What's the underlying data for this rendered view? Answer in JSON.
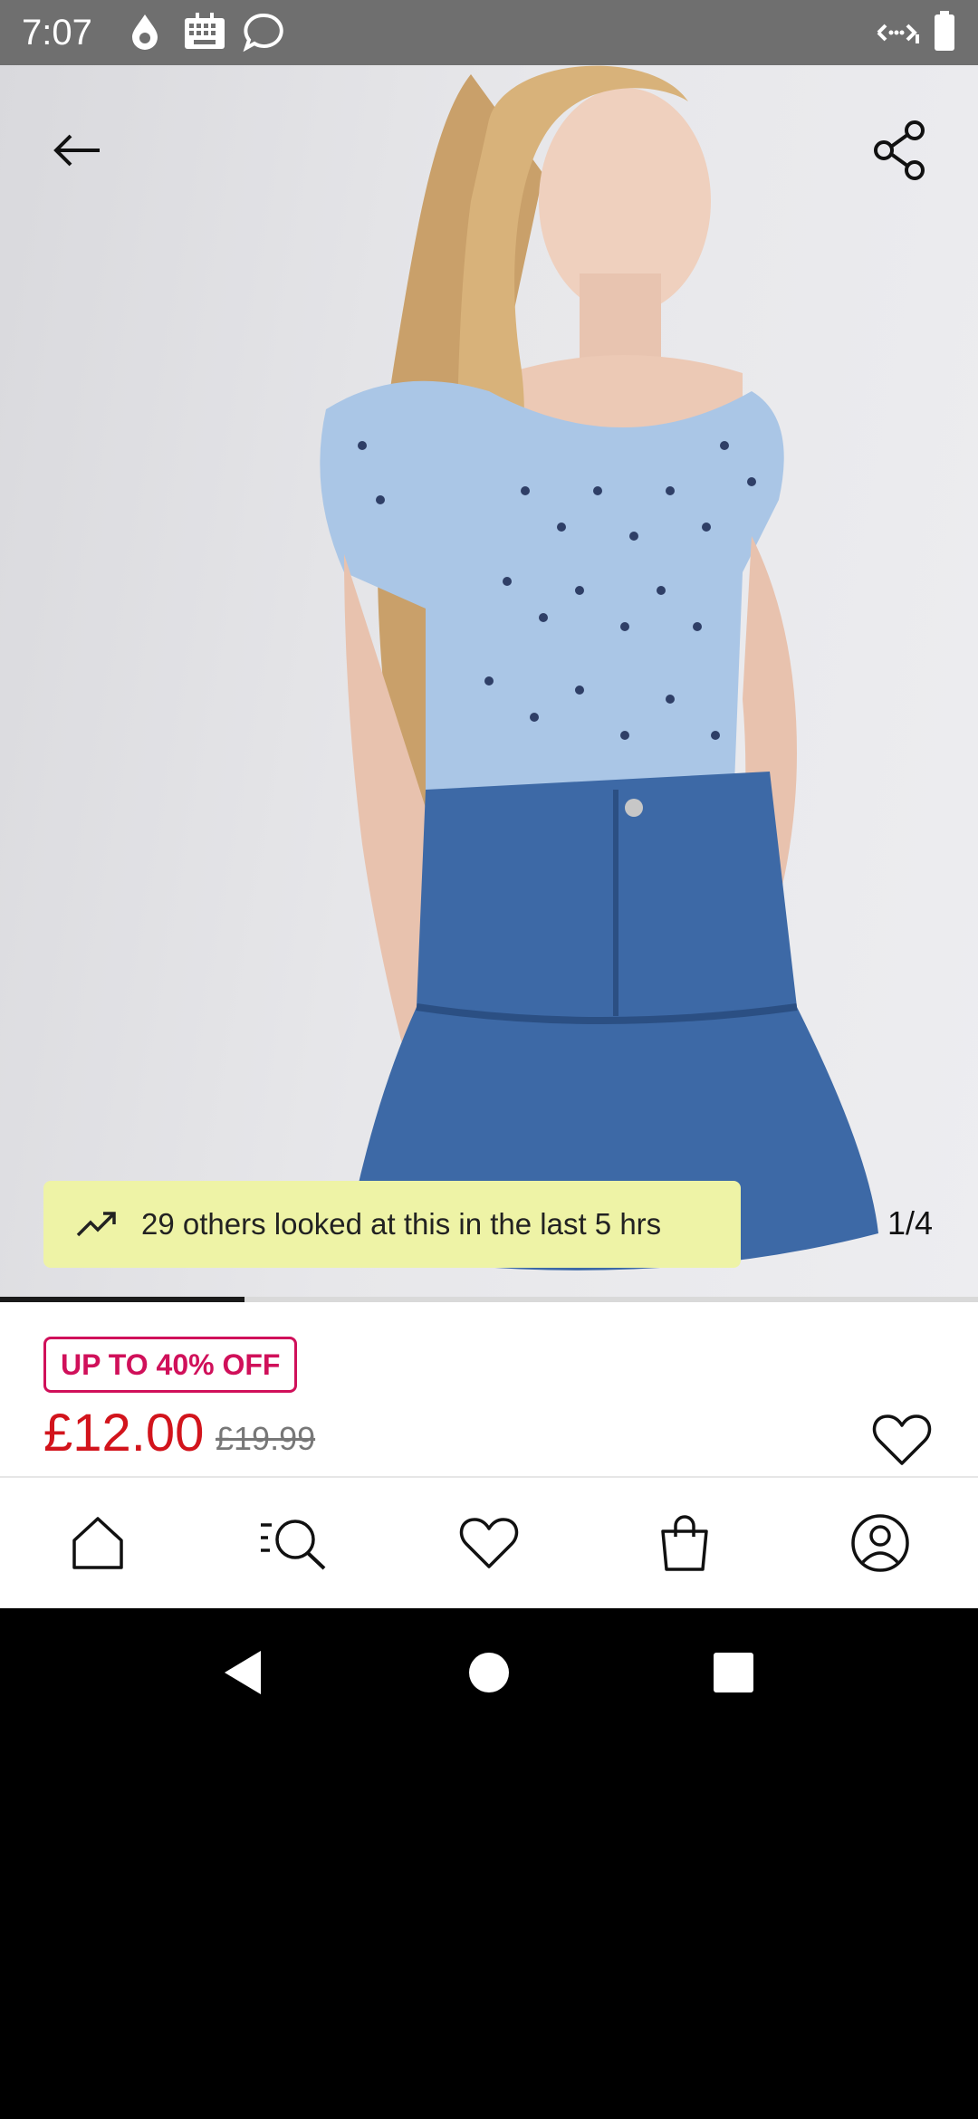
{
  "status_bar": {
    "time": "7:07",
    "icons": [
      "drop-icon",
      "keyboard-icon",
      "chat-bubble-icon",
      "wifi-icon",
      "battery-icon"
    ]
  },
  "product": {
    "image": {
      "description_icon": "product-photo",
      "current_page": "1/4",
      "progress": 0.25
    },
    "trend_banner": {
      "icon": "trending-up-icon",
      "text": "29 others looked at this in the last 5 hrs"
    },
    "discount_badge": "UP TO 40% OFF",
    "price": "£12.00",
    "original_price": "£19.99"
  },
  "colors": {
    "sale_pink": "#d0105a",
    "price_red": "#d2141c",
    "banner_yellow": "#eef3a6"
  },
  "bottom_nav": {
    "items": [
      "home-icon",
      "search-icon",
      "wishlist-icon",
      "bag-icon",
      "account-icon"
    ]
  },
  "system_nav": {
    "items": [
      "back-icon",
      "home-circle-icon",
      "recents-icon"
    ]
  }
}
